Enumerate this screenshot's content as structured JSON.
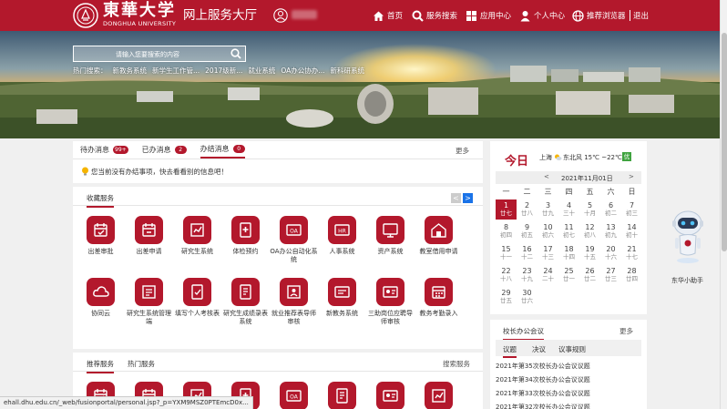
{
  "header": {
    "logo_cn": "東華大学",
    "logo_en": "DONGHUA UNIVERSITY",
    "title": "网上服务大厅",
    "nav": [
      {
        "label": "首页",
        "icon": "home-icon"
      },
      {
        "label": "服务搜索",
        "icon": "search-icon"
      },
      {
        "label": "应用中心",
        "icon": "grid-icon"
      },
      {
        "label": "个人中心",
        "icon": "person-icon"
      },
      {
        "label": "推荐浏览器",
        "icon": "browser-icon"
      }
    ],
    "logout": "退出"
  },
  "search": {
    "placeholder": "请输入您要搜索的内容",
    "hot_label": "热门搜索：",
    "hot_items": [
      "新教务系统",
      "新学生工作管...",
      "2017级新...",
      "就业系统",
      "OA办公协办...",
      "新科研系统"
    ]
  },
  "messages": {
    "tabs": [
      {
        "label": "待办消息",
        "count": "99+"
      },
      {
        "label": "已办消息",
        "count": "2"
      },
      {
        "label": "办结消息",
        "count": "0"
      }
    ],
    "more": "更多",
    "empty_text": "您当前没有办结事项，快去看看别的信息吧！"
  },
  "favorites": {
    "title": "收藏服务",
    "prev": "<",
    "next": ">",
    "items": [
      {
        "label": "出差审批",
        "icon": "travel-approval-icon"
      },
      {
        "label": "出差申请",
        "icon": "travel-apply-icon"
      },
      {
        "label": "研究生系统",
        "icon": "graduate-system-icon"
      },
      {
        "label": "体检预约",
        "icon": "medical-checkup-icon"
      },
      {
        "label": "OA办公自动化系统",
        "icon": "oa-system-icon"
      },
      {
        "label": "人事系统",
        "icon": "hr-system-icon"
      },
      {
        "label": "资产系统",
        "icon": "asset-system-icon"
      },
      {
        "label": "教室借用申请",
        "icon": "classroom-booking-icon"
      },
      {
        "label": "协同云",
        "icon": "cloud-icon"
      },
      {
        "label": "研究生系统管理端",
        "icon": "graduate-admin-icon"
      },
      {
        "label": "填写个人考核表",
        "icon": "assessment-form-icon"
      },
      {
        "label": "研究生成绩录表系统",
        "icon": "grade-entry-icon"
      },
      {
        "label": "就业推荐表导师审核",
        "icon": "employment-review-icon"
      },
      {
        "label": "新教务系统",
        "icon": "academic-system-icon"
      },
      {
        "label": "三助岗位应聘导师审核",
        "icon": "assistant-review-icon"
      },
      {
        "label": "教务考勤录入",
        "icon": "attendance-icon"
      }
    ]
  },
  "recommend": {
    "tabs": [
      "推荐服务",
      "热门服务"
    ],
    "search": "搜索服务"
  },
  "calendar": {
    "today": "今日",
    "city": "上海",
    "weather": "东北风 15℃ ~22℃",
    "aqi": "优",
    "prev": "<",
    "next": ">",
    "month": "2021年11月01日",
    "weekdays": [
      "一",
      "二",
      "三",
      "四",
      "五",
      "六",
      "日"
    ],
    "days": [
      {
        "d": "1",
        "l": "廿七"
      },
      {
        "d": "2",
        "l": "廿八"
      },
      {
        "d": "3",
        "l": "廿九"
      },
      {
        "d": "4",
        "l": "三十"
      },
      {
        "d": "5",
        "l": "十月"
      },
      {
        "d": "6",
        "l": "初二"
      },
      {
        "d": "7",
        "l": "初三"
      },
      {
        "d": "8",
        "l": "初四"
      },
      {
        "d": "9",
        "l": "初五"
      },
      {
        "d": "10",
        "l": "初六"
      },
      {
        "d": "11",
        "l": "初七"
      },
      {
        "d": "12",
        "l": "初八"
      },
      {
        "d": "13",
        "l": "初九"
      },
      {
        "d": "14",
        "l": "初十"
      },
      {
        "d": "15",
        "l": "十一"
      },
      {
        "d": "16",
        "l": "十二"
      },
      {
        "d": "17",
        "l": "十三"
      },
      {
        "d": "18",
        "l": "十四"
      },
      {
        "d": "19",
        "l": "十五"
      },
      {
        "d": "20",
        "l": "十六"
      },
      {
        "d": "21",
        "l": "十七"
      },
      {
        "d": "22",
        "l": "十八"
      },
      {
        "d": "23",
        "l": "十九"
      },
      {
        "d": "24",
        "l": "二十"
      },
      {
        "d": "25",
        "l": "廿一"
      },
      {
        "d": "26",
        "l": "廿二"
      },
      {
        "d": "27",
        "l": "廿三"
      },
      {
        "d": "28",
        "l": "廿四"
      },
      {
        "d": "29",
        "l": "廿五"
      },
      {
        "d": "30",
        "l": "廿六"
      }
    ]
  },
  "president_meeting": {
    "title": "校长办公会议",
    "more": "更多",
    "tabs": [
      "议题",
      "决议",
      "议事规则"
    ],
    "items": [
      "2021年第35次校长办公会议议题",
      "2021年第34次校长办公会议议题",
      "2021年第33次校长办公会议议题",
      "2021年第32次校长办公会议议题"
    ]
  },
  "assistant": {
    "label": "东华小助手"
  },
  "status_url": "ehall.dhu.edu.cn/_web/fusionportal/personal.jsp?_p=YXM9MSZ0PTEmcD0x...",
  "colors": {
    "brand": "#b3182c",
    "accent_blue": "#1a73e8"
  }
}
